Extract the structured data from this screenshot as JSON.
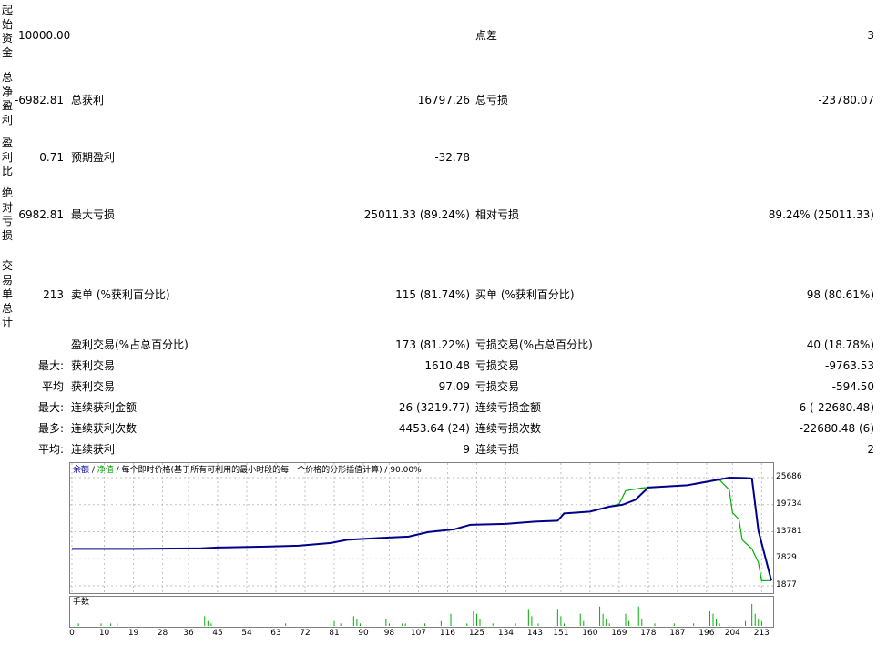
{
  "stats": {
    "initial_deposit_label": "起始资金",
    "initial_deposit": "10000.00",
    "spread_label": "点差",
    "spread": "3",
    "net_profit_label": "总净盈利",
    "net_profit": "-6982.81",
    "gross_profit_label": "总获利",
    "gross_profit": "16797.26",
    "gross_loss_label": "总亏损",
    "gross_loss": "-23780.07",
    "profit_factor_label": "盈利比",
    "profit_factor": "0.71",
    "expected_payoff_label": "预期盈利",
    "expected_payoff": "-32.78",
    "abs_drawdown_label": "绝对亏损",
    "abs_drawdown": "6982.81",
    "max_drawdown_label": "最大亏损",
    "max_drawdown": "25011.33 (89.24%)",
    "rel_drawdown_label": "相对亏损",
    "rel_drawdown": "89.24% (25011.33)",
    "total_trades_label": "交易单总计",
    "total_trades": "213",
    "short_label": "卖单 (%获利百分比)",
    "short_value": "115 (81.74%)",
    "long_label": "买单 (%获利百分比)",
    "long_value": "98 (80.61%)",
    "profit_trades_label": "盈利交易(%占总百分比)",
    "profit_trades": "173 (81.22%)",
    "loss_trades_label": "亏损交易(%占总百分比)",
    "loss_trades": "40 (18.78%)",
    "largest_prefix": "最大:",
    "largest_profit_label": "获利交易",
    "largest_profit": "1610.48",
    "largest_loss_label": "亏损交易",
    "largest_loss": "-9763.53",
    "average_prefix": "平均",
    "avg_profit_label": "获利交易",
    "avg_profit": "97.09",
    "avg_loss_label": "亏损交易",
    "avg_loss": "-594.50",
    "max_prefix": "最大:",
    "max_consec_wins_label": "连续获利金额",
    "max_consec_wins": "26 (3219.77)",
    "max_consec_losses_label": "连续亏损金额",
    "max_consec_losses": "6 (-22680.48)",
    "most_prefix": "最多:",
    "maximal_consec_profit_label": "连续获利次数",
    "maximal_consec_profit": "4453.64 (24)",
    "maximal_consec_loss_label": "连续亏损次数",
    "maximal_consec_loss": "-22680.48 (6)",
    "avg2_prefix": "平均:",
    "avg_consec_wins_label": "连续获利",
    "avg_consec_wins": "9",
    "avg_consec_losses_label": "连续亏损",
    "avg_consec_losses": "2"
  },
  "chart": {
    "caption_balance": "余额",
    "caption_sep1": " / ",
    "caption_equity": "净值",
    "caption_rest": " / 每个即时价格(基于所有可利用的最小时段的每一个价格的分形插值计算) / 90.00%",
    "volume_caption": "手数",
    "colors": {
      "balance": "#00008b",
      "equity": "#00b000",
      "grid": "#c0c0c0"
    }
  },
  "chart_data": {
    "type": "line",
    "x": [
      0,
      10,
      19,
      28,
      36,
      45,
      54,
      63,
      72,
      81,
      90,
      98,
      107,
      116,
      125,
      134,
      143,
      151,
      160,
      169,
      178,
      187,
      196,
      204,
      213
    ],
    "ylim": [
      1877,
      25686
    ],
    "yticks": [
      "25686",
      "19734",
      "13781",
      "7829",
      "1877"
    ],
    "xticks": [
      "0",
      "10",
      "19",
      "28",
      "36",
      "45",
      "54",
      "63",
      "72",
      "81",
      "90",
      "98",
      "107",
      "116",
      "125",
      "134",
      "143",
      "151",
      "160",
      "169",
      "178",
      "187",
      "196",
      "204",
      "213"
    ],
    "series": [
      {
        "key": "balance",
        "points": [
          [
            0,
            10000
          ],
          [
            20,
            10000
          ],
          [
            40,
            10150
          ],
          [
            45,
            10300
          ],
          [
            60,
            10500
          ],
          [
            70,
            10700
          ],
          [
            80,
            11300
          ],
          [
            85,
            12000
          ],
          [
            95,
            12400
          ],
          [
            104,
            12700
          ],
          [
            110,
            13700
          ],
          [
            118,
            14300
          ],
          [
            123,
            15300
          ],
          [
            134,
            15500
          ],
          [
            143,
            16000
          ],
          [
            150,
            16200
          ],
          [
            152,
            17800
          ],
          [
            160,
            18200
          ],
          [
            166,
            19300
          ],
          [
            170,
            19700
          ],
          [
            174,
            20800
          ],
          [
            178,
            23500
          ],
          [
            190,
            24000
          ],
          [
            203,
            25686
          ],
          [
            208,
            25600
          ],
          [
            210,
            25500
          ],
          [
            212,
            14000
          ],
          [
            216,
            3017
          ]
        ]
      },
      {
        "key": "equity",
        "points": [
          [
            0,
            10000
          ],
          [
            20,
            10000
          ],
          [
            40,
            10150
          ],
          [
            45,
            10300
          ],
          [
            60,
            10500
          ],
          [
            70,
            10700
          ],
          [
            80,
            11300
          ],
          [
            85,
            12000
          ],
          [
            95,
            12400
          ],
          [
            104,
            12700
          ],
          [
            110,
            13700
          ],
          [
            118,
            14300
          ],
          [
            123,
            15300
          ],
          [
            134,
            15500
          ],
          [
            143,
            16000
          ],
          [
            150,
            16200
          ],
          [
            152,
            17800
          ],
          [
            160,
            18200
          ],
          [
            166,
            19300
          ],
          [
            169,
            19900
          ],
          [
            171,
            22800
          ],
          [
            176,
            23400
          ],
          [
            190,
            24000
          ],
          [
            200,
            25200
          ],
          [
            203,
            23000
          ],
          [
            204,
            18000
          ],
          [
            206,
            16500
          ],
          [
            207,
            12000
          ],
          [
            210,
            10000
          ],
          [
            212,
            7000
          ],
          [
            213,
            3000
          ],
          [
            214,
            3017
          ],
          [
            216,
            3017
          ]
        ]
      }
    ],
    "volume": [
      [
        2,
        1
      ],
      [
        9,
        1
      ],
      [
        12,
        1
      ],
      [
        14,
        1
      ],
      [
        41,
        4
      ],
      [
        42,
        2
      ],
      [
        43,
        1
      ],
      [
        66,
        1
      ],
      [
        80,
        3
      ],
      [
        81,
        2
      ],
      [
        83,
        1
      ],
      [
        87,
        4
      ],
      [
        88,
        3
      ],
      [
        89,
        1
      ],
      [
        97,
        3
      ],
      [
        98,
        1
      ],
      [
        102,
        1
      ],
      [
        103,
        1
      ],
      [
        109,
        1
      ],
      [
        114,
        2
      ],
      [
        117,
        5
      ],
      [
        118,
        1
      ],
      [
        122,
        1
      ],
      [
        124,
        6
      ],
      [
        125,
        5
      ],
      [
        126,
        3
      ],
      [
        130,
        1
      ],
      [
        137,
        1
      ],
      [
        141,
        7
      ],
      [
        142,
        4
      ],
      [
        144,
        1
      ],
      [
        150,
        7
      ],
      [
        151,
        4
      ],
      [
        152,
        1
      ],
      [
        157,
        5
      ],
      [
        158,
        2
      ],
      [
        163,
        8
      ],
      [
        164,
        5
      ],
      [
        165,
        3
      ],
      [
        166,
        1
      ],
      [
        171,
        5
      ],
      [
        172,
        2
      ],
      [
        175,
        8
      ],
      [
        176,
        3
      ],
      [
        180,
        1
      ],
      [
        186,
        1
      ],
      [
        192,
        1
      ],
      [
        197,
        6
      ],
      [
        198,
        5
      ],
      [
        199,
        3
      ],
      [
        200,
        1
      ],
      [
        208,
        2
      ],
      [
        210,
        9
      ],
      [
        211,
        5
      ],
      [
        212,
        3
      ],
      [
        213,
        2
      ]
    ]
  }
}
